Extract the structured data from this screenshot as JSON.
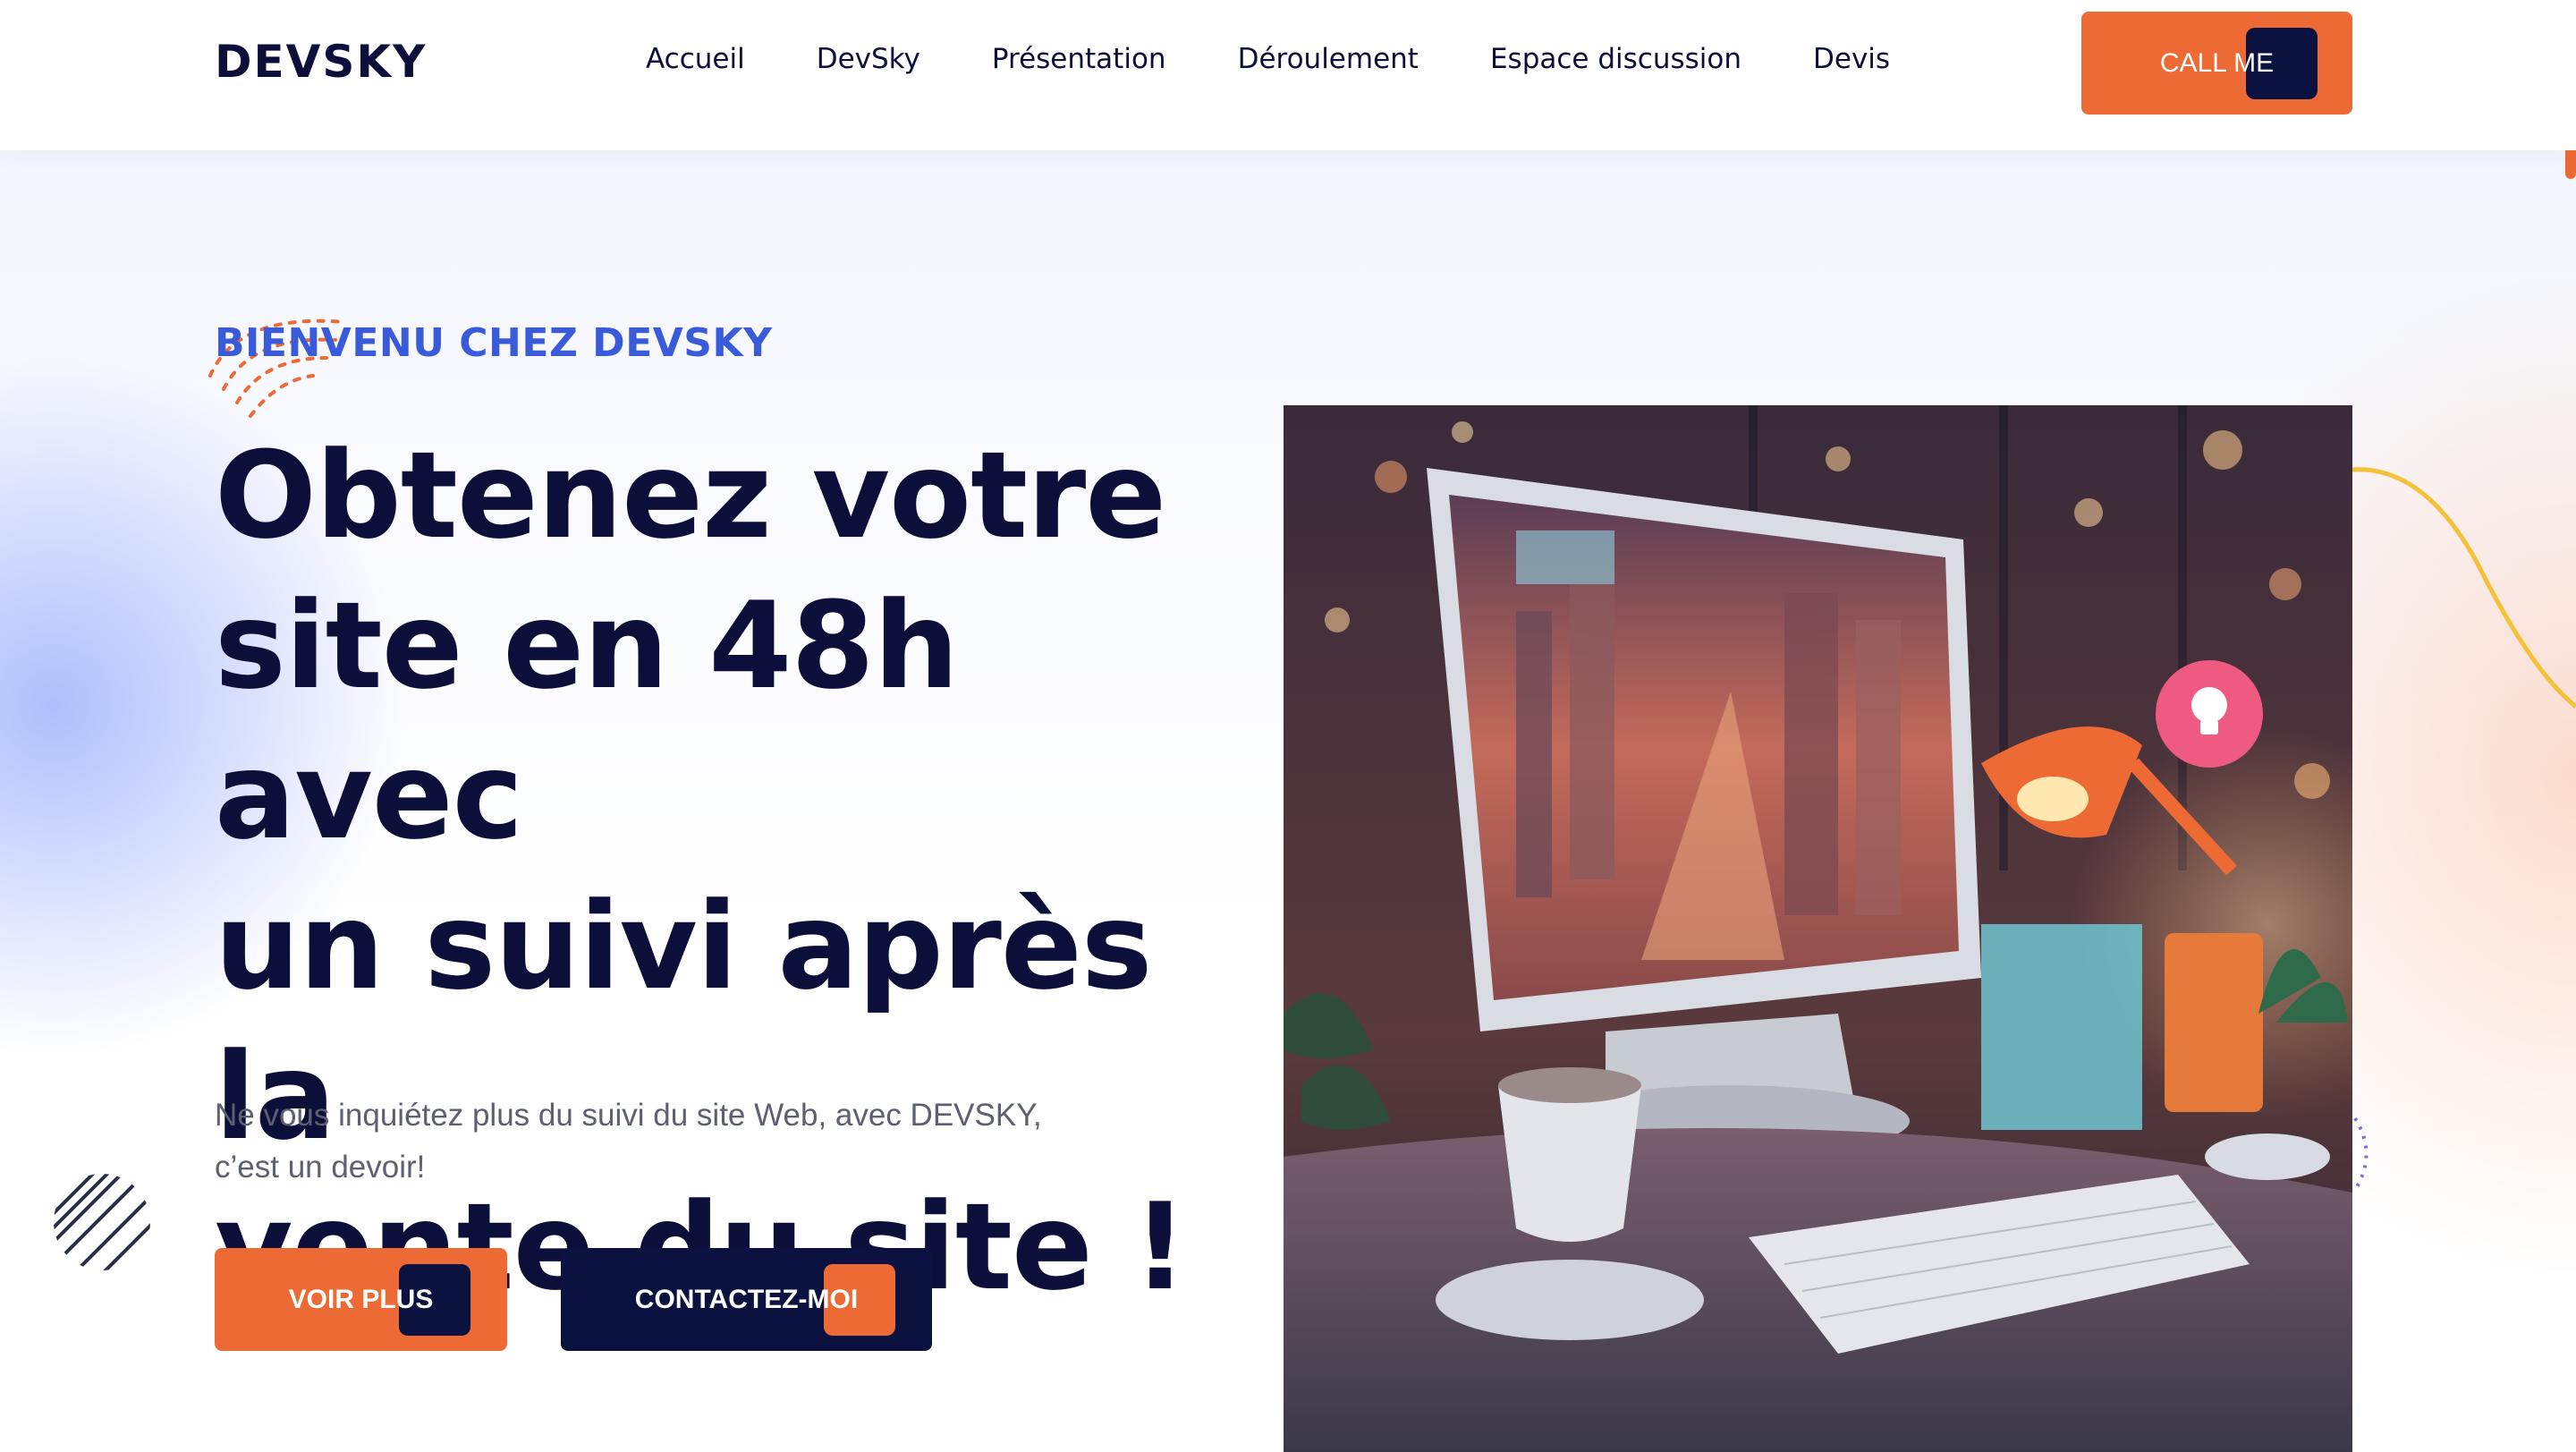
{
  "brand": {
    "logo": "DEVSKY",
    "accent": "#ee6a35",
    "navy": "#0b1240",
    "blue": "#3a5bd9"
  },
  "nav": {
    "items": [
      "Accueil",
      "DevSky",
      "Présentation",
      "Déroulement",
      "Espace discussion",
      "Devis"
    ],
    "cta": "CALL ME"
  },
  "hero": {
    "eyebrow": "BIENVENU CHEZ DEVSKY",
    "headline_lines": [
      "Obtenez votre",
      "site en 48h avec",
      "un suivi après la",
      "vente du site !"
    ],
    "subtitle_lines": [
      "Ne vous inquiétez plus du suivi du site Web, avec DEVSKY,",
      "c’est un devoir!"
    ],
    "primary_button": "VOIR PLUS",
    "secondary_button": "CONTACTEZ-MOI"
  }
}
